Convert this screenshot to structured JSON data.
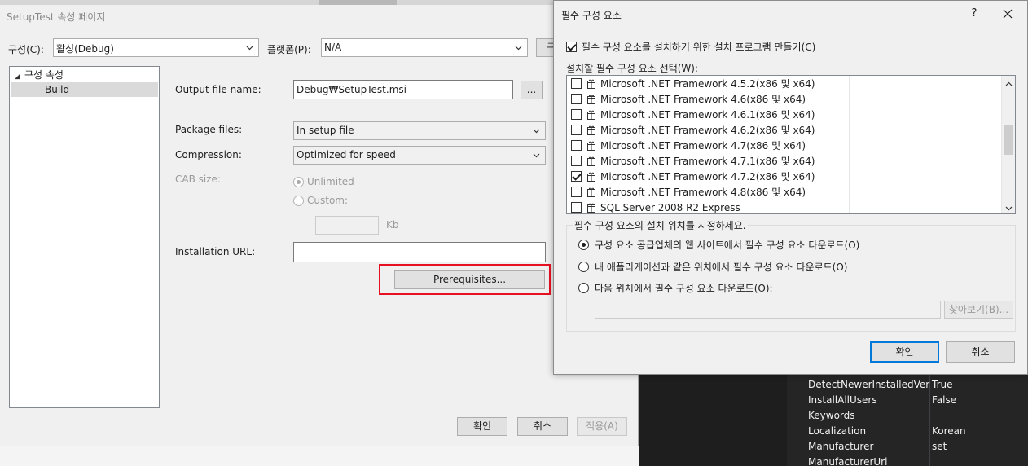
{
  "main_window": {
    "title": "SetupTest 속성 페이지",
    "config_label": "구성(C):",
    "config_value": "활성(Debug)",
    "platform_label": "플랫폼(P):",
    "platform_value": "N/A",
    "config_manager_button": "구",
    "tree": {
      "root": "구성 속성",
      "selected": "Build"
    },
    "output_file_label": "Output file name:",
    "output_file_value": "Debug₩SetupTest.msi",
    "browse_button": "...",
    "package_files_label": "Package files:",
    "package_files_value": "In setup file",
    "compression_label": "Compression:",
    "compression_value": "Optimized for speed",
    "cab_size_label": "CAB size:",
    "unlimited_label": "Unlimited",
    "custom_label": "Custom:",
    "kb_label": "Kb",
    "installation_url_label": "Installation URL:",
    "installation_url_value": "",
    "prerequisites_button": "Prerequisites...",
    "ok_button": "확인",
    "cancel_button": "취소",
    "apply_button": "적용(A)"
  },
  "property_grid": {
    "rows": [
      {
        "name": "DetectNewerInstalledVersio",
        "value": "True"
      },
      {
        "name": "InstallAllUsers",
        "value": "False"
      },
      {
        "name": "Keywords",
        "value": ""
      },
      {
        "name": "Localization",
        "value": "Korean"
      },
      {
        "name": "Manufacturer",
        "value": "set"
      },
      {
        "name": "ManufacturerUrl",
        "value": ""
      }
    ]
  },
  "dialog": {
    "title": "필수 구성 요소",
    "help_label": "?",
    "create_setup_label": "필수 구성 요소를 설치하기 위한 설치 프로그램 만들기(C)",
    "create_setup_checked": true,
    "choose_label": "설치할 필수 구성 요소 선택(W):",
    "items": [
      {
        "label": "Microsoft .NET Framework 4.5.2(x86 및 x64)",
        "checked": false
      },
      {
        "label": "Microsoft .NET Framework 4.6(x86 및 x64)",
        "checked": false
      },
      {
        "label": "Microsoft .NET Framework 4.6.1(x86 및 x64)",
        "checked": false
      },
      {
        "label": "Microsoft .NET Framework 4.6.2(x86 및 x64)",
        "checked": false
      },
      {
        "label": "Microsoft .NET Framework 4.7(x86 및 x64)",
        "checked": false
      },
      {
        "label": "Microsoft .NET Framework 4.7.1(x86 및 x64)",
        "checked": false
      },
      {
        "label": "Microsoft .NET Framework 4.7.2(x86 및 x64)",
        "checked": true
      },
      {
        "label": "Microsoft .NET Framework 4.8(x86 및 x64)",
        "checked": false
      },
      {
        "label": "SQL Server 2008 R2 Express",
        "checked": false
      }
    ],
    "location_group_title": "필수 구성 요소의 설치 위치를 지정하세요.",
    "location_options": [
      {
        "label": "구성 요소 공급업체의 웹 사이트에서 필수 구성 요소 다운로드(O)",
        "checked": true
      },
      {
        "label": "내 애플리케이션과 같은 위치에서 필수 구성 요소 다운로드(O)",
        "checked": false
      },
      {
        "label": "다음 위치에서 필수 구성 요소 다운로드(O):",
        "checked": false
      }
    ],
    "location_path_value": "",
    "browse_button": "찾아보기(B)...",
    "ok_button": "확인",
    "cancel_button": "취소"
  },
  "colors": {
    "highlight_box": "#e81123",
    "primary_button_border": "#0078d7",
    "dark_background": "#1e1e1e"
  }
}
